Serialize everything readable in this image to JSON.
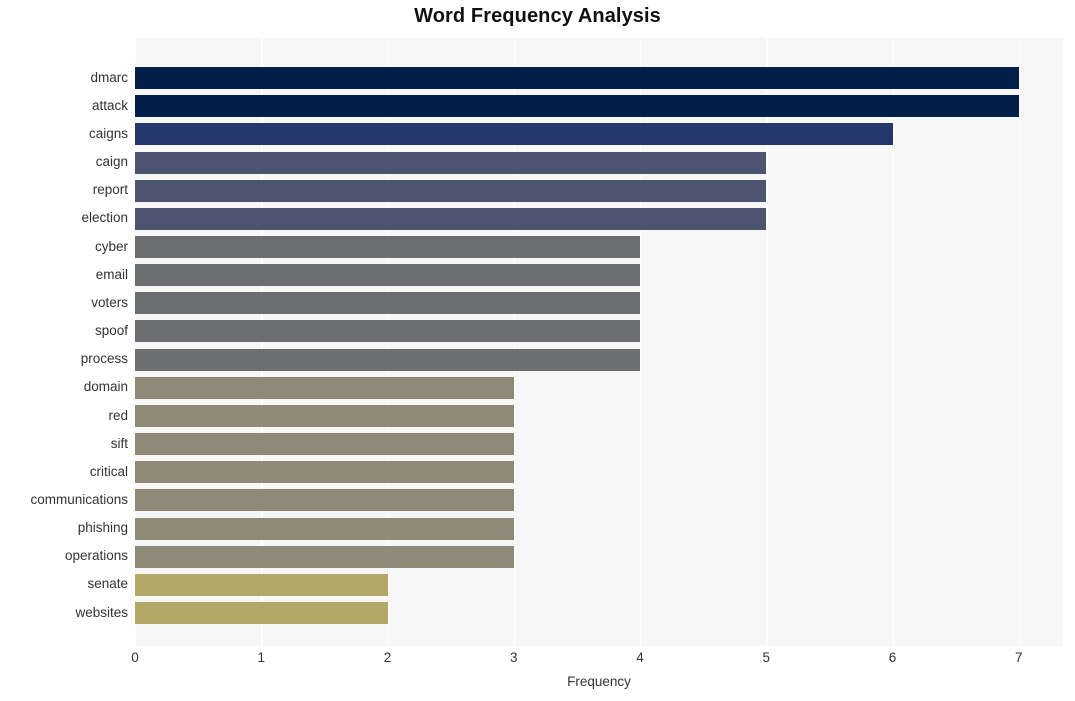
{
  "chart_data": {
    "type": "bar",
    "orientation": "horizontal",
    "title": "Word Frequency Analysis",
    "xlabel": "Frequency",
    "ylabel": "",
    "xlim": [
      0,
      7.35
    ],
    "xticks": [
      0,
      1,
      2,
      3,
      4,
      5,
      6,
      7
    ],
    "xtick_labels": [
      "0",
      "1",
      "2",
      "3",
      "4",
      "5",
      "6",
      "7"
    ],
    "grid": "vertical-white-on-light-gray",
    "legend": "none",
    "categories": [
      "dmarc",
      "attack",
      "caigns",
      "caign",
      "report",
      "election",
      "cyber",
      "email",
      "voters",
      "spoof",
      "process",
      "domain",
      "red",
      "sift",
      "critical",
      "communications",
      "phishing",
      "operations",
      "senate",
      "websites"
    ],
    "values": [
      7,
      7,
      6,
      5,
      5,
      5,
      4,
      4,
      4,
      4,
      4,
      3,
      3,
      3,
      3,
      3,
      3,
      3,
      2,
      2
    ],
    "bar_colors": [
      "#04204a",
      "#04204a",
      "#24386e",
      "#4c5470",
      "#4c5470",
      "#4c5470",
      "#6c6e71",
      "#6c6e71",
      "#6c6e71",
      "#6c6e71",
      "#6c6e71",
      "#8e8a78",
      "#8e8a78",
      "#8e8a78",
      "#8e8a78",
      "#8e8a78",
      "#8e8a78",
      "#8e8a78",
      "#b3a866",
      "#b3a866"
    ]
  },
  "style": {
    "plot_background": "#f7f7f8",
    "grid_color": "#ffffff",
    "figure_background": "#ffffff",
    "title_color": "#111111",
    "tick_color": "#333333"
  }
}
